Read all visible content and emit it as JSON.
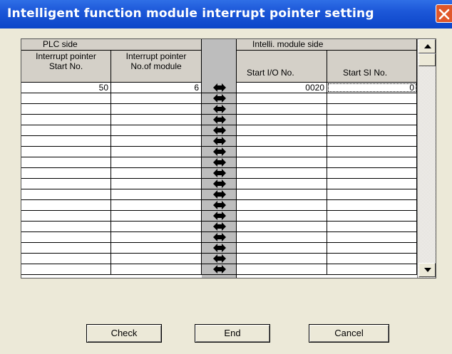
{
  "window": {
    "title": "Intelligent function module interrupt pointer setting"
  },
  "table": {
    "plc_side_label": "PLC side",
    "intelli_side_label": "Intelli. module side",
    "columns": {
      "start_no": [
        "Interrupt pointer",
        "Start No."
      ],
      "no_of_module": [
        "Interrupt pointer",
        "No.of module"
      ],
      "start_io": "Start I/O No.",
      "start_si": "Start SI No."
    },
    "rows": [
      {
        "start_no": "50",
        "no_of_module": "6",
        "start_io": "0020",
        "start_si": "0"
      },
      {
        "start_no": "",
        "no_of_module": "",
        "start_io": "",
        "start_si": ""
      },
      {
        "start_no": "",
        "no_of_module": "",
        "start_io": "",
        "start_si": ""
      },
      {
        "start_no": "",
        "no_of_module": "",
        "start_io": "",
        "start_si": ""
      },
      {
        "start_no": "",
        "no_of_module": "",
        "start_io": "",
        "start_si": ""
      },
      {
        "start_no": "",
        "no_of_module": "",
        "start_io": "",
        "start_si": ""
      },
      {
        "start_no": "",
        "no_of_module": "",
        "start_io": "",
        "start_si": ""
      },
      {
        "start_no": "",
        "no_of_module": "",
        "start_io": "",
        "start_si": ""
      },
      {
        "start_no": "",
        "no_of_module": "",
        "start_io": "",
        "start_si": ""
      },
      {
        "start_no": "",
        "no_of_module": "",
        "start_io": "",
        "start_si": ""
      },
      {
        "start_no": "",
        "no_of_module": "",
        "start_io": "",
        "start_si": ""
      },
      {
        "start_no": "",
        "no_of_module": "",
        "start_io": "",
        "start_si": ""
      },
      {
        "start_no": "",
        "no_of_module": "",
        "start_io": "",
        "start_si": ""
      },
      {
        "start_no": "",
        "no_of_module": "",
        "start_io": "",
        "start_si": ""
      },
      {
        "start_no": "",
        "no_of_module": "",
        "start_io": "",
        "start_si": ""
      },
      {
        "start_no": "",
        "no_of_module": "",
        "start_io": "",
        "start_si": ""
      },
      {
        "start_no": "",
        "no_of_module": "",
        "start_io": "",
        "start_si": ""
      },
      {
        "start_no": "",
        "no_of_module": "",
        "start_io": "",
        "start_si": ""
      }
    ],
    "link_icon": "double-arrow-icon"
  },
  "buttons": {
    "check": "Check",
    "end": "End",
    "cancel": "Cancel"
  },
  "colors": {
    "title_bar": "#0b45c8",
    "close_button": "#e0572a",
    "dialog_bg": "#ece9d8",
    "header_bg": "#d4d0c8",
    "link_column": "#bdbdbd"
  }
}
